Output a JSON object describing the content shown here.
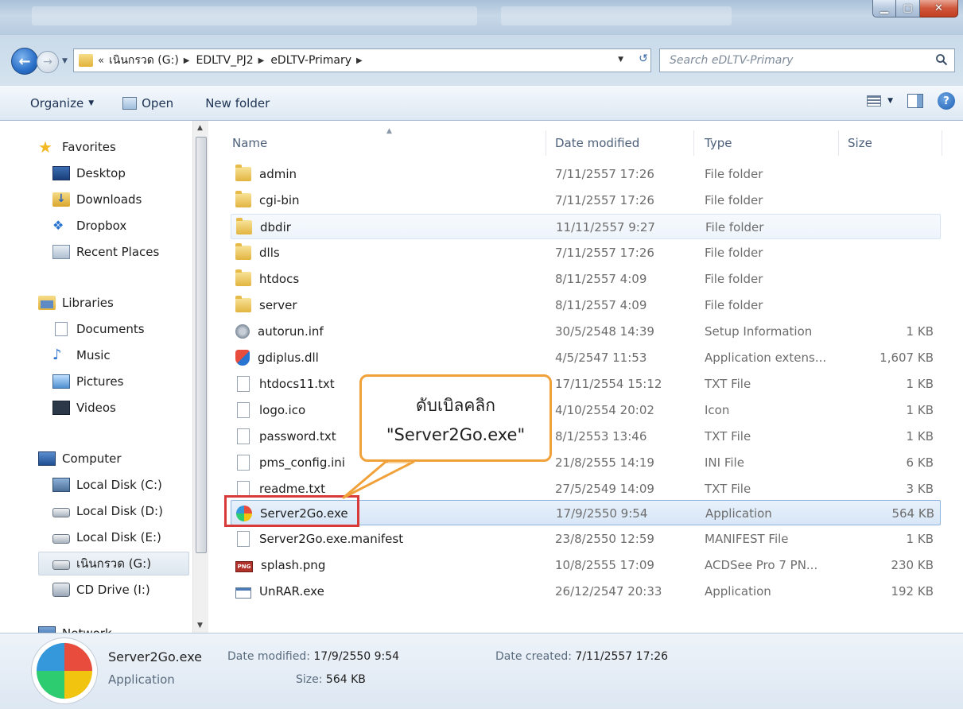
{
  "window": {
    "controls": {
      "minimize": "▁",
      "maximize": "▢",
      "close": "✕"
    }
  },
  "address": {
    "overflow": "«",
    "crumbs": [
      "เนินกรวด (G:)",
      "EDLTV_PJ2",
      "eDLTV-Primary"
    ],
    "search_placeholder": "Search eDLTV-Primary"
  },
  "toolbar": {
    "organize": "Organize",
    "open": "Open",
    "new_folder": "New folder"
  },
  "nav": {
    "favorites": "Favorites",
    "desktop": "Desktop",
    "downloads": "Downloads",
    "dropbox": "Dropbox",
    "recent": "Recent Places",
    "libraries": "Libraries",
    "documents": "Documents",
    "music": "Music",
    "pictures": "Pictures",
    "videos": "Videos",
    "computer": "Computer",
    "disk_c": "Local Disk (C:)",
    "disk_d": "Local Disk (D:)",
    "disk_e": "Local Disk (E:)",
    "disk_g": "เนินกรวด (G:)",
    "cd": "CD Drive (I:)",
    "network": "Network"
  },
  "columns": {
    "name": "Name",
    "date": "Date modified",
    "type": "Type",
    "size": "Size"
  },
  "files": [
    {
      "name": "admin",
      "date": "7/11/2557 17:26",
      "type": "File folder",
      "size": ""
    },
    {
      "name": "cgi-bin",
      "date": "7/11/2557 17:26",
      "type": "File folder",
      "size": ""
    },
    {
      "name": "dbdir",
      "date": "11/11/2557 9:27",
      "type": "File folder",
      "size": ""
    },
    {
      "name": "dlls",
      "date": "7/11/2557 17:26",
      "type": "File folder",
      "size": ""
    },
    {
      "name": "htdocs",
      "date": "8/11/2557 4:09",
      "type": "File folder",
      "size": ""
    },
    {
      "name": "server",
      "date": "8/11/2557 4:09",
      "type": "File folder",
      "size": ""
    },
    {
      "name": "autorun.inf",
      "date": "30/5/2548 14:39",
      "type": "Setup Information",
      "size": "1 KB"
    },
    {
      "name": "gdiplus.dll",
      "date": "4/5/2547 11:53",
      "type": "Application extens...",
      "size": "1,607 KB"
    },
    {
      "name": "htdocs11.txt",
      "date": "17/11/2554 15:12",
      "type": "TXT File",
      "size": "1 KB"
    },
    {
      "name": "logo.ico",
      "date": "4/10/2554 20:02",
      "type": "Icon",
      "size": "1 KB"
    },
    {
      "name": "password.txt",
      "date": "8/1/2553 13:46",
      "type": "TXT File",
      "size": "1 KB"
    },
    {
      "name": "pms_config.ini",
      "date": "21/8/2555 14:19",
      "type": "INI File",
      "size": "6 KB"
    },
    {
      "name": "readme.txt",
      "date": "27/5/2549 14:09",
      "type": "TXT File",
      "size": "3 KB"
    },
    {
      "name": "Server2Go.exe",
      "date": "17/9/2550 9:54",
      "type": "Application",
      "size": "564 KB"
    },
    {
      "name": "Server2Go.exe.manifest",
      "date": "23/8/2550 12:59",
      "type": "MANIFEST File",
      "size": "1 KB"
    },
    {
      "name": "splash.png",
      "date": "10/8/2555 17:09",
      "type": "ACDSee Pro 7 PN...",
      "size": "230 KB"
    },
    {
      "name": "UnRAR.exe",
      "date": "26/12/2547 20:33",
      "type": "Application",
      "size": "192 KB"
    }
  ],
  "callout": {
    "line1": "ดับเบิลคลิก",
    "line2": "\"Server2Go.exe\""
  },
  "details": {
    "name": "Server2Go.exe",
    "type": "Application",
    "modified_label": "Date modified:",
    "modified_value": "17/9/2550 9:54",
    "size_label": "Size:",
    "size_value": "564 KB",
    "created_label": "Date created:",
    "created_value": "7/11/2557 17:26"
  },
  "colors": {
    "accent": "#d83a3a",
    "callout_border": "#f1a13a",
    "selection": "#d7e6f7"
  }
}
